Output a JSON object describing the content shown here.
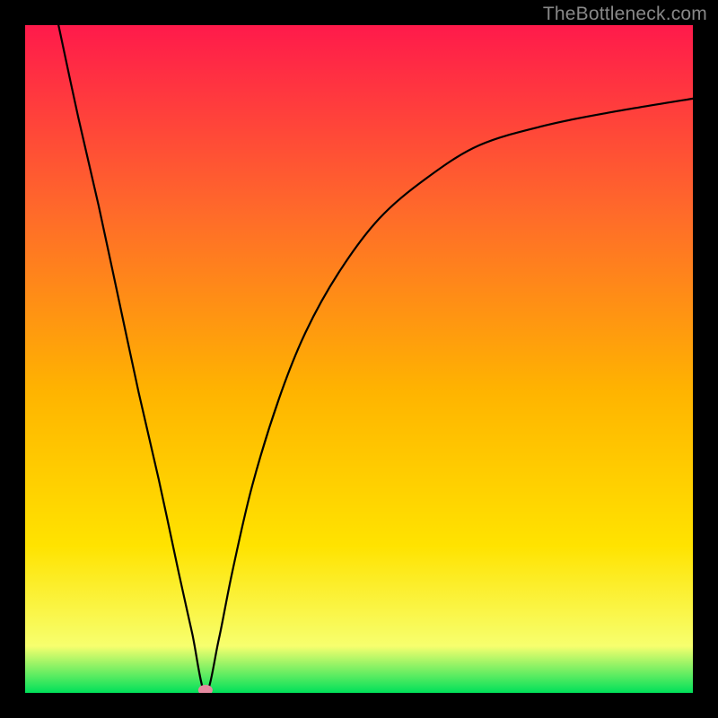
{
  "attribution": "TheBottleneck.com",
  "gradient_colors": {
    "top": "#ff1a4b",
    "upper_mid": "#ff6a2a",
    "mid": "#ffb400",
    "lower_mid": "#ffe300",
    "near_bottom": "#f7ff6e",
    "bottom": "#00e05a"
  },
  "chart_data": {
    "type": "line",
    "title": "",
    "xlabel": "",
    "ylabel": "",
    "xlim": [
      0,
      100
    ],
    "ylim": [
      0,
      100
    ],
    "legend": false,
    "grid": false,
    "notes": "Single black curve drops steeply from top-left (≈x=5,y=100) to a minimum at (≈27, 0) then rises with decreasing slope toward (100, ≈89). A small pink marker sits at the minimum.",
    "series": [
      {
        "name": "bottleneck-curve",
        "points": [
          {
            "x": 5,
            "y": 100
          },
          {
            "x": 8,
            "y": 86
          },
          {
            "x": 11,
            "y": 73
          },
          {
            "x": 14,
            "y": 59
          },
          {
            "x": 17,
            "y": 45
          },
          {
            "x": 20,
            "y": 32
          },
          {
            "x": 23,
            "y": 18
          },
          {
            "x": 25,
            "y": 9
          },
          {
            "x": 27,
            "y": 0
          },
          {
            "x": 29,
            "y": 8
          },
          {
            "x": 31,
            "y": 18
          },
          {
            "x": 34,
            "y": 31
          },
          {
            "x": 38,
            "y": 44
          },
          {
            "x": 42,
            "y": 54
          },
          {
            "x": 47,
            "y": 63
          },
          {
            "x": 53,
            "y": 71
          },
          {
            "x": 60,
            "y": 77
          },
          {
            "x": 68,
            "y": 82
          },
          {
            "x": 78,
            "y": 85
          },
          {
            "x": 88,
            "y": 87
          },
          {
            "x": 100,
            "y": 89
          }
        ]
      }
    ],
    "marker": {
      "x": 27,
      "y": 0,
      "color": "#e58aa0"
    }
  }
}
